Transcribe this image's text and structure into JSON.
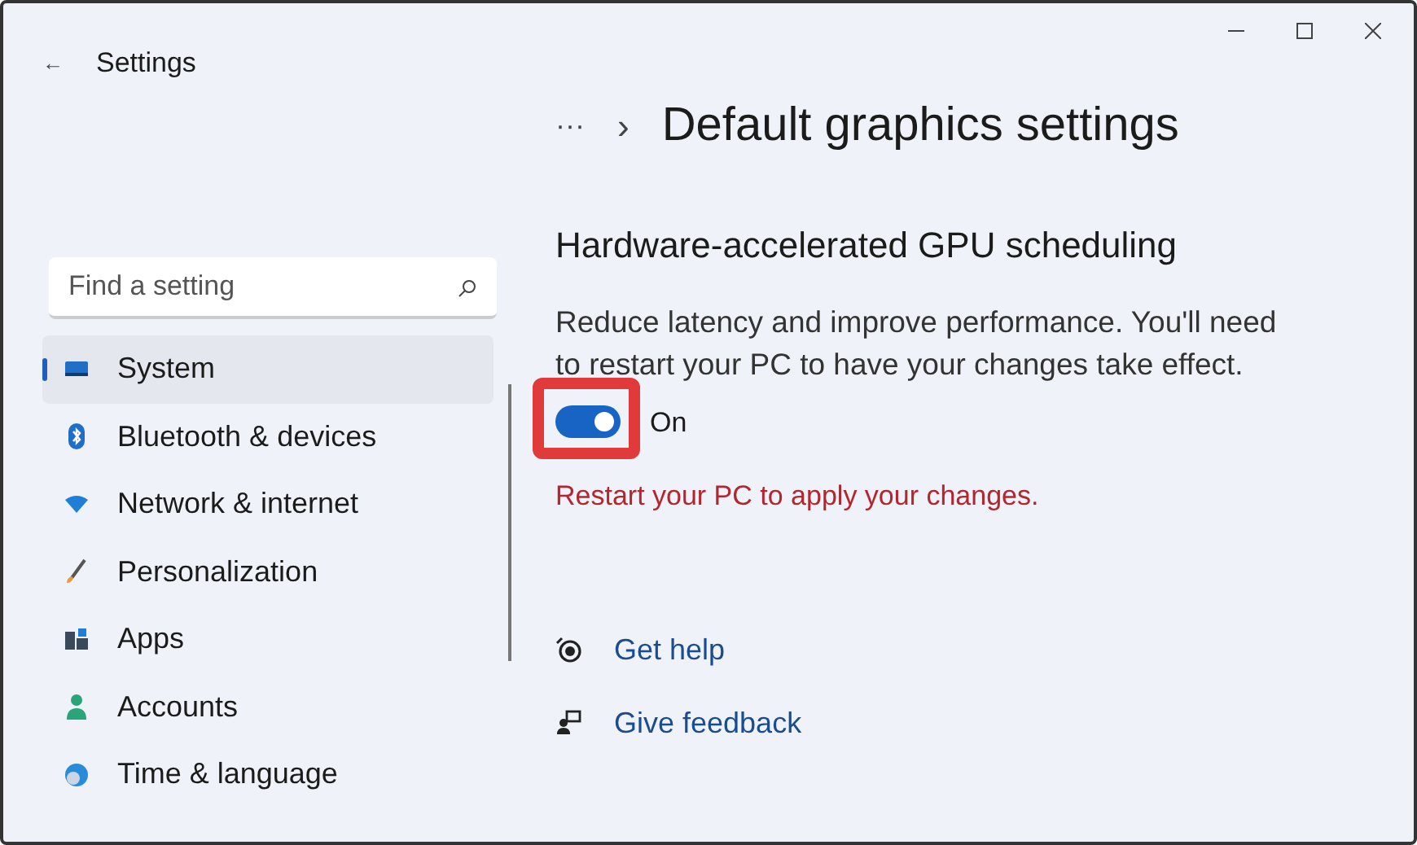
{
  "window": {
    "back": "←",
    "title": "Settings"
  },
  "search": {
    "placeholder": "Find a setting"
  },
  "sidebar": {
    "items": [
      {
        "label": "System",
        "selected": true
      },
      {
        "label": "Bluetooth & devices",
        "selected": false
      },
      {
        "label": "Network & internet",
        "selected": false
      },
      {
        "label": "Personalization",
        "selected": false
      },
      {
        "label": "Apps",
        "selected": false
      },
      {
        "label": "Accounts",
        "selected": false
      },
      {
        "label": "Time & language",
        "selected": false
      }
    ]
  },
  "breadcrumb": {
    "ellipsis": "···",
    "separator": "›",
    "title": "Default graphics settings"
  },
  "section": {
    "heading": "Hardware-accelerated GPU scheduling",
    "description": "Reduce latency and improve performance. You'll need to restart your PC to have your changes take effect.",
    "toggle": {
      "on": true,
      "label": "On",
      "highlighted": true
    },
    "warning": "Restart your PC to apply your changes."
  },
  "links": [
    {
      "label": "Get help"
    },
    {
      "label": "Give feedback"
    }
  ]
}
